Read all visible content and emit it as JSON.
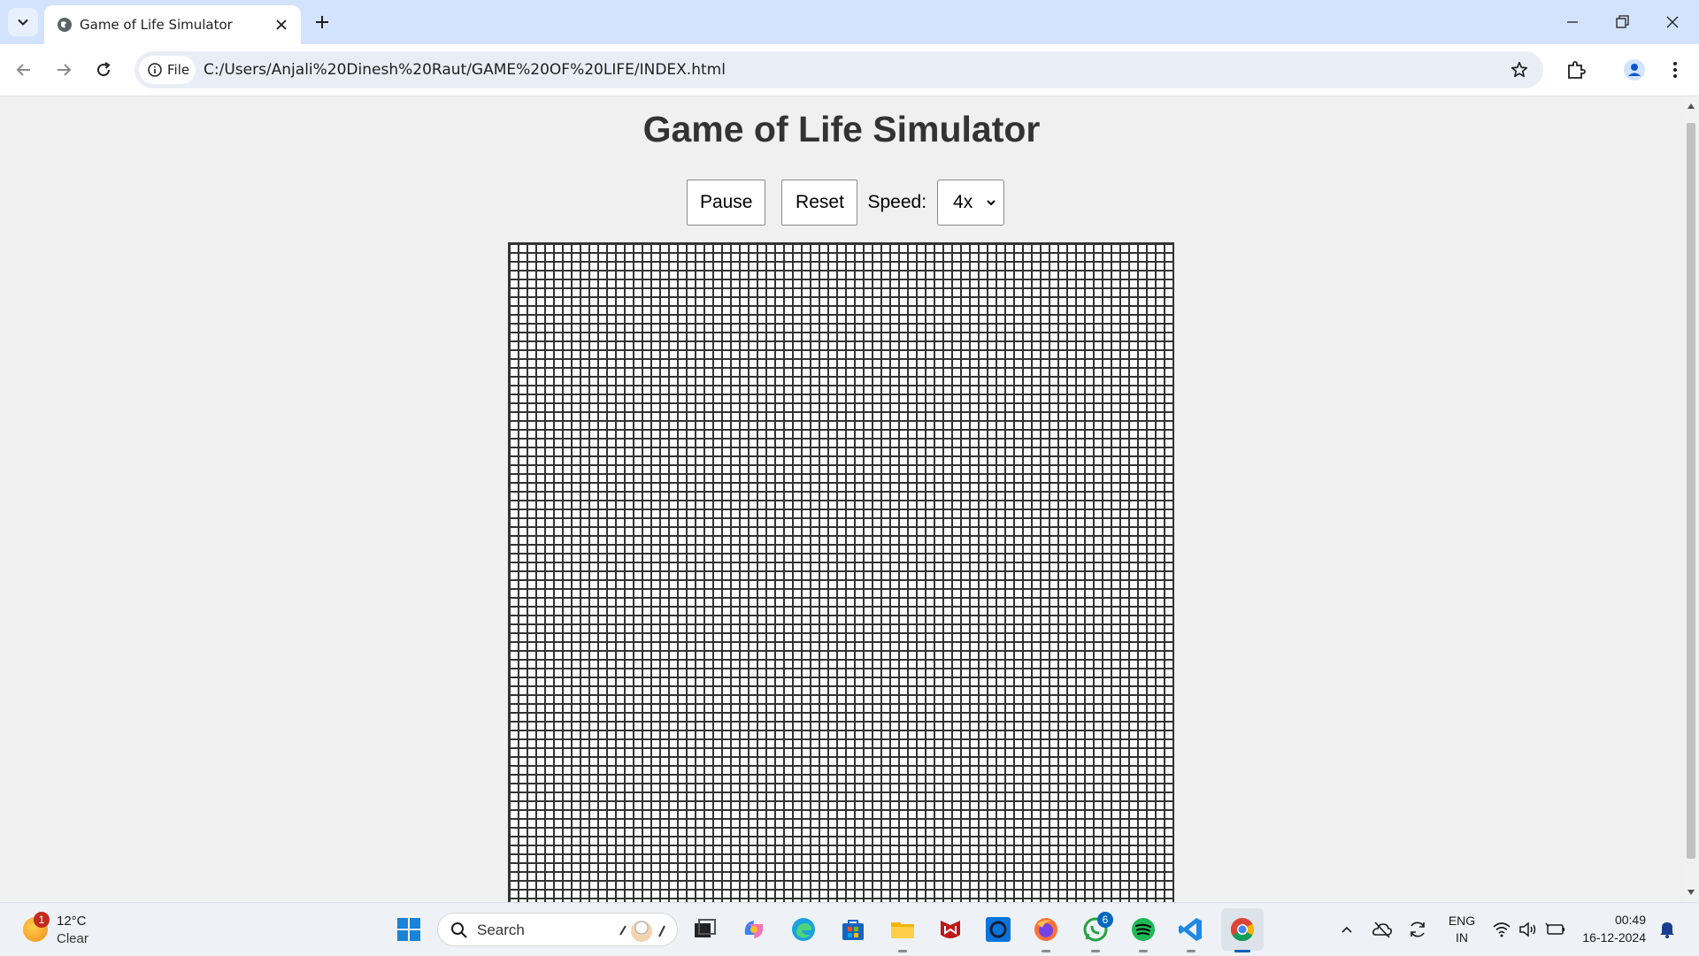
{
  "browser": {
    "tab_title": "Game of Life Simulator",
    "url": "C:/Users/Anjali%20Dinesh%20Raut/GAME%20OF%20LIFE/INDEX.html",
    "chip_label": "File"
  },
  "page": {
    "title": "Game of Life Simulator",
    "pause_label": "Pause",
    "reset_label": "Reset",
    "speed_label": "Speed:",
    "speed_value": "4x"
  },
  "taskbar": {
    "weather_temp": "12°C",
    "weather_condition": "Clear",
    "weather_badge": "1",
    "search_placeholder": "Search",
    "whatsapp_badge": "6",
    "lang_top": "ENG",
    "lang_bottom": "IN",
    "time": "00:49",
    "date": "16-12-2024"
  },
  "colors": {
    "tabstrip": "#d3e3fd",
    "page_bg": "#f0f0f0",
    "grid_line": "#333333",
    "active_indicator": "#005fb8"
  }
}
